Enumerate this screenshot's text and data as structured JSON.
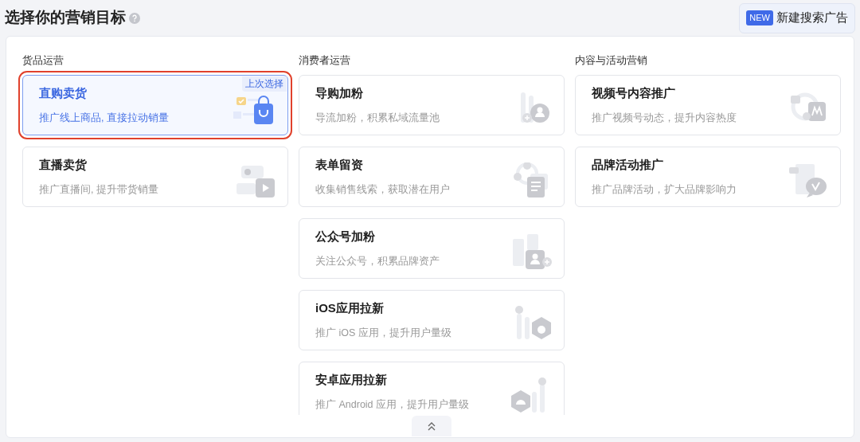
{
  "header": {
    "title": "选择你的营销目标",
    "new_badge": "NEW",
    "new_button": "新建搜索广告"
  },
  "columns": [
    {
      "title": "货品运营",
      "cards": [
        {
          "title": "直购卖货",
          "subtitle": "推广线上商品, 直接拉动销量",
          "selected": true,
          "badge": "上次选择"
        },
        {
          "title": "直播卖货",
          "subtitle": "推广直播间, 提升带货销量",
          "selected": false
        }
      ]
    },
    {
      "title": "消费者运营",
      "cards": [
        {
          "title": "导购加粉",
          "subtitle": "导流加粉，积累私域流量池",
          "selected": false
        },
        {
          "title": "表单留资",
          "subtitle": "收集销售线索，获取潜在用户",
          "selected": false
        },
        {
          "title": "公众号加粉",
          "subtitle": "关注公众号，积累品牌资产",
          "selected": false
        },
        {
          "title": "iOS应用拉新",
          "subtitle": "推广 iOS 应用，提升用户量级",
          "selected": false
        },
        {
          "title": "安卓应用拉新",
          "subtitle": "推广 Android 应用，提升用户量级",
          "selected": false
        }
      ]
    },
    {
      "title": "内容与活动营销",
      "cards": [
        {
          "title": "视频号内容推广",
          "subtitle": "推广视频号动态，提升内容热度",
          "selected": false
        },
        {
          "title": "品牌活动推广",
          "subtitle": "推广品牌活动，扩大品牌影响力",
          "selected": false
        }
      ]
    }
  ]
}
